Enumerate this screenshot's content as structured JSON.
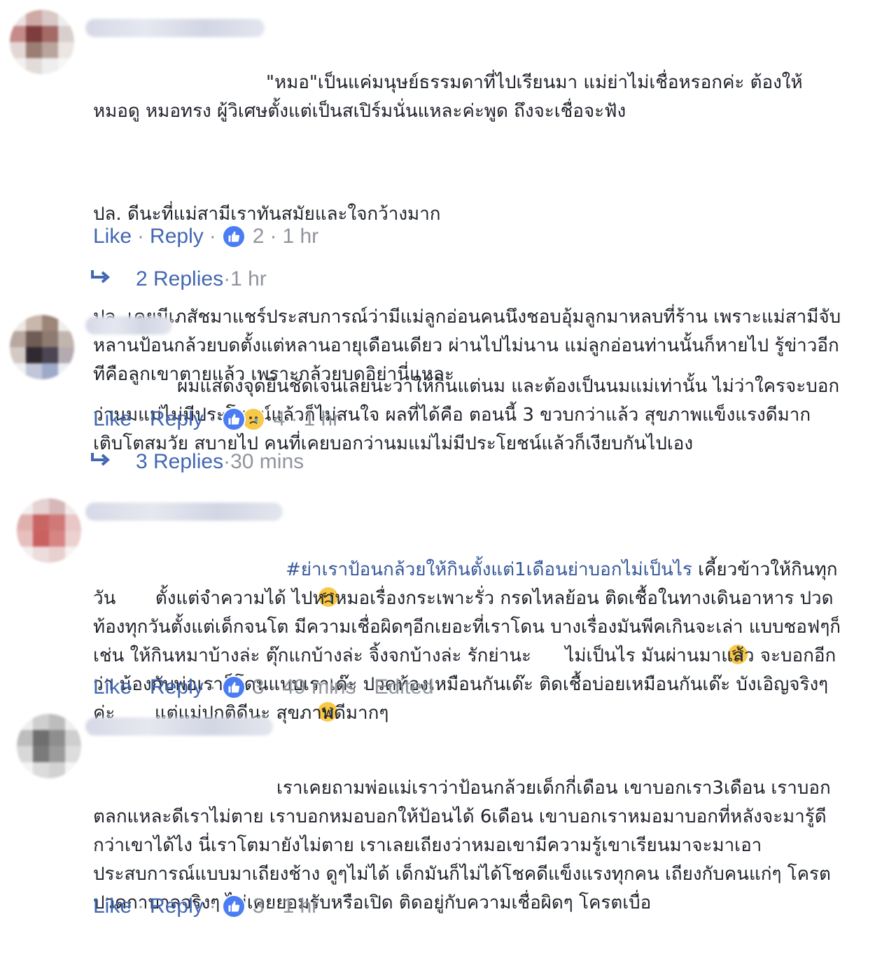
{
  "reaction_colors": {
    "like": "#4a7cf4",
    "sad": "#f7c94a",
    "link": "#4267b2",
    "meta": "#90949c"
  },
  "comments": [
    {
      "author": "",
      "paragraphs": [
        "\"หมอ\"เป็นแค่มนุษย์ธรรมดาที่ไปเรียนมา แม่ย่าไม่เชื่อหรอกค่ะ ต้องให้หมอดู หมอทรง ผู้วิเศษตั้งแต่เป็นสเปิร์มนั่นแหละค่ะพูด ถึงจะเชื่อจะฟัง",
        "ปล. ดีนะที่แม่สามีเราทันสมัยและใจกว้างมาก",
        "ปล. เคยมีเภสัชมาแชร์ประสบการณ์ว่ามีแม่ลูกอ่อนคนนึงชอบอุ้มลูกมาหลบที่ร้าน เพราะแม่สามีจับหลานป้อนกล้วยบดตั้งแต่หลานอายุเดือนเดียว ผ่านไปไม่นาน แม่ลูกอ่อนท่านนั้นก็หายไป รู้ข่าวอีกทีคือลูกเขาตายแล้ว เพราะกล้วยบดอิย่านี่แหละ"
      ],
      "like_label": "Like",
      "reply_label": "Reply",
      "reaction_icons": [
        "like-icon"
      ],
      "reaction_count": "2",
      "time": "1 hr",
      "edited": "",
      "replies_label": "2 Replies",
      "replies_time": "1 hr"
    },
    {
      "author": "",
      "paragraphs": [
        "ผมแสดงจุดยืนชัดเจนเลยนะว่าให้กินแต่นม และต้องเป็นนมแม่เท่านั้น ไม่ว่าใครจะบอกว่านมแม่ไม่มีประโยชน์แล้วก็ไม่สนใจ ผลที่ได้คือ ตอนนี้ 3 ขวบกว่าแล้ว สุขภาพแข็งแรงดีมาก เติบโตสมวัย สบายไป คนที่เคยบอกว่านมแม่ไม่มีประโยชน์แล้วก็เงียบกันไปเอง"
      ],
      "like_label": "Like",
      "reply_label": "Reply",
      "reaction_icons": [
        "like-icon",
        "sad-icon"
      ],
      "reaction_count": "4",
      "time": "1 hr",
      "edited": "",
      "replies_label": "3 Replies",
      "replies_time": "30 mins"
    },
    {
      "author": "",
      "hashtag": "#ย่าเราป้อนกล้วยให้กินตั้งแต่1เดือนย่าบอกไม่เป็นไร",
      "text_a": " เคี้ยวข้าวให้กินทุกวัน ",
      "text_b": " ตั้งแต่จำความได้ ไปหาหมอเรื่องกระเพาะรั่ว กรดไหลย้อน ติดเชื้อในทางเดินอาหาร ปวดท้องทุกวันตั้งแต่เด็กจนโต มีความเชื่อผิดๆอีกเยอะที่เราโดน บางเรื่องมันพีคเกินจะเล่า แบบชอฟๆก็ เช่น ให้กินหมาบ้างล่ะ ตุ๊กแกบ้างล่ะ จิ้งจกบ้างล่ะ รักย่านะ",
      "text_c": " ไม่เป็นไร มันผ่านมาแล้ว จะบอกอีกว่า น้องกับพ่อเราก็โดนแบบเราเด๊ะ ปวดท้องเหมือนกันเด๊ะ ติดเชื้อบ่อยเหมือนกันเด๊ะ บังเอิญจริงๆค่ะ ",
      "text_d": " แต่แม่ปกติดีนะ สุขภาพดีมากๆ",
      "like_label": "Like",
      "reply_label": "Reply",
      "reaction_icons": [
        "like-icon"
      ],
      "reaction_count": "3",
      "time": "49 mins",
      "edited": "Edited"
    },
    {
      "author": "",
      "paragraphs": [
        "เราเคยถามพ่อแม่เราว่าป้อนกล้วยเด็กกี่เดือน เขาบอกเรา3เดือน เราบอกตลกแหละดีเราไม่ตาย เราบอกหมอบอกให้ป้อนได้ 6เดือน เขาบอกเราหมอมาบอกที่หลังจะมารู้ดีกว่าเขาได้ไง นี่เราโตมายังไม่ตาย เราเลยเถียงว่าหมอเขามีความรู้เขาเรียนมาจะมาเอาประสบการณ์แบบมาเถียงช้าง ดูๆไม่ได้ เด็กมันก็ไม่ได้โชคดีแข็งแรงทุกคน เถียงกับคนแก่ๆ โครตปวดกาบาลจริงๆ ไม่เคยยอมรับหรือเปิด ติดอยู่กับความเชื่อผิดๆ โครตเบื่อ"
      ],
      "like_label": "Like",
      "reply_label": "Reply",
      "reaction_icons": [
        "like-icon"
      ],
      "reaction_count": "3",
      "time": "1 hr",
      "edited": ""
    }
  ]
}
